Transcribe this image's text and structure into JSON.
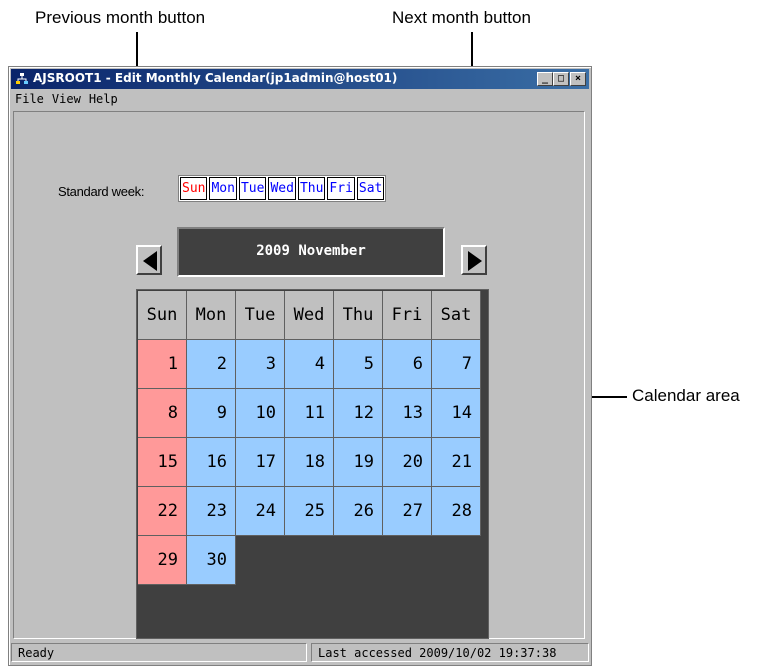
{
  "annotations": {
    "prev_month": "Previous month button",
    "next_month": "Next month button",
    "calendar_area": "Calendar area"
  },
  "window": {
    "title": "AJSROOT1 - Edit Monthly Calendar(jp1admin@host01)",
    "controls": [
      "_",
      "□",
      "×"
    ]
  },
  "menu": [
    "File",
    "View",
    "Help"
  ],
  "standard_week": {
    "label": "Standard week:",
    "days": [
      {
        "label": "Sun",
        "color": "#ff0000"
      },
      {
        "label": "Mon",
        "color": "#0000ff"
      },
      {
        "label": "Tue",
        "color": "#0000ff"
      },
      {
        "label": "Wed",
        "color": "#0000ff"
      },
      {
        "label": "Thu",
        "color": "#0000ff"
      },
      {
        "label": "Fri",
        "color": "#0000ff"
      },
      {
        "label": "Sat",
        "color": "#0000ff"
      }
    ]
  },
  "month_display": "2009 November",
  "calendar": {
    "headers": [
      "Sun",
      "Mon",
      "Tue",
      "Wed",
      "Thu",
      "Fri",
      "Sat"
    ],
    "weeks": [
      [
        "1",
        "2",
        "3",
        "4",
        "5",
        "6",
        "7"
      ],
      [
        "8",
        "9",
        "10",
        "11",
        "12",
        "13",
        "14"
      ],
      [
        "15",
        "16",
        "17",
        "18",
        "19",
        "20",
        "21"
      ],
      [
        "22",
        "23",
        "24",
        "25",
        "26",
        "27",
        "28"
      ],
      [
        "29",
        "30",
        "",
        "",
        "",
        "",
        ""
      ],
      [
        "",
        "",
        "",
        "",
        "",
        "",
        ""
      ]
    ],
    "colors": {
      "sunday": "#ff9999",
      "weekday": "#99ccff",
      "empty": "#404040"
    }
  },
  "status": {
    "left": "Ready",
    "right": "Last accessed 2009/10/02 19:37:38"
  }
}
